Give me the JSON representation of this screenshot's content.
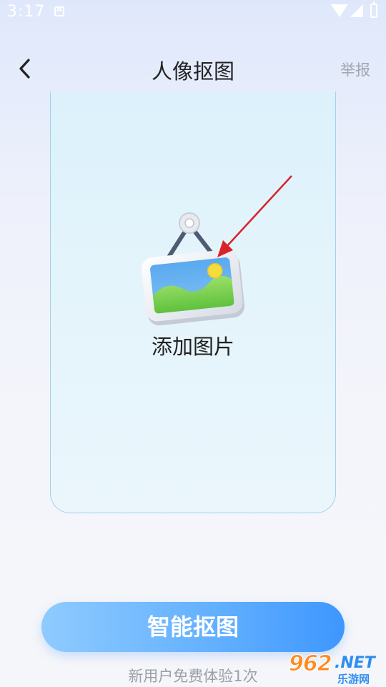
{
  "status_bar": {
    "time": "3:17"
  },
  "header": {
    "title": "人像抠图",
    "report_label": "举报"
  },
  "upload": {
    "label": "添加图片"
  },
  "actions": {
    "primary_label": "智能抠图",
    "trial_text": "新用户免费体验1次"
  },
  "watermark": {
    "number": "962",
    "suffix": ".NET",
    "subtitle": "乐游网"
  },
  "colors": {
    "accent": "#4A9EFF",
    "arrow": "#d9232b"
  },
  "icons": [
    "back-icon",
    "picture-frame-icon",
    "wifi-icon",
    "signal-icon",
    "battery-icon"
  ]
}
